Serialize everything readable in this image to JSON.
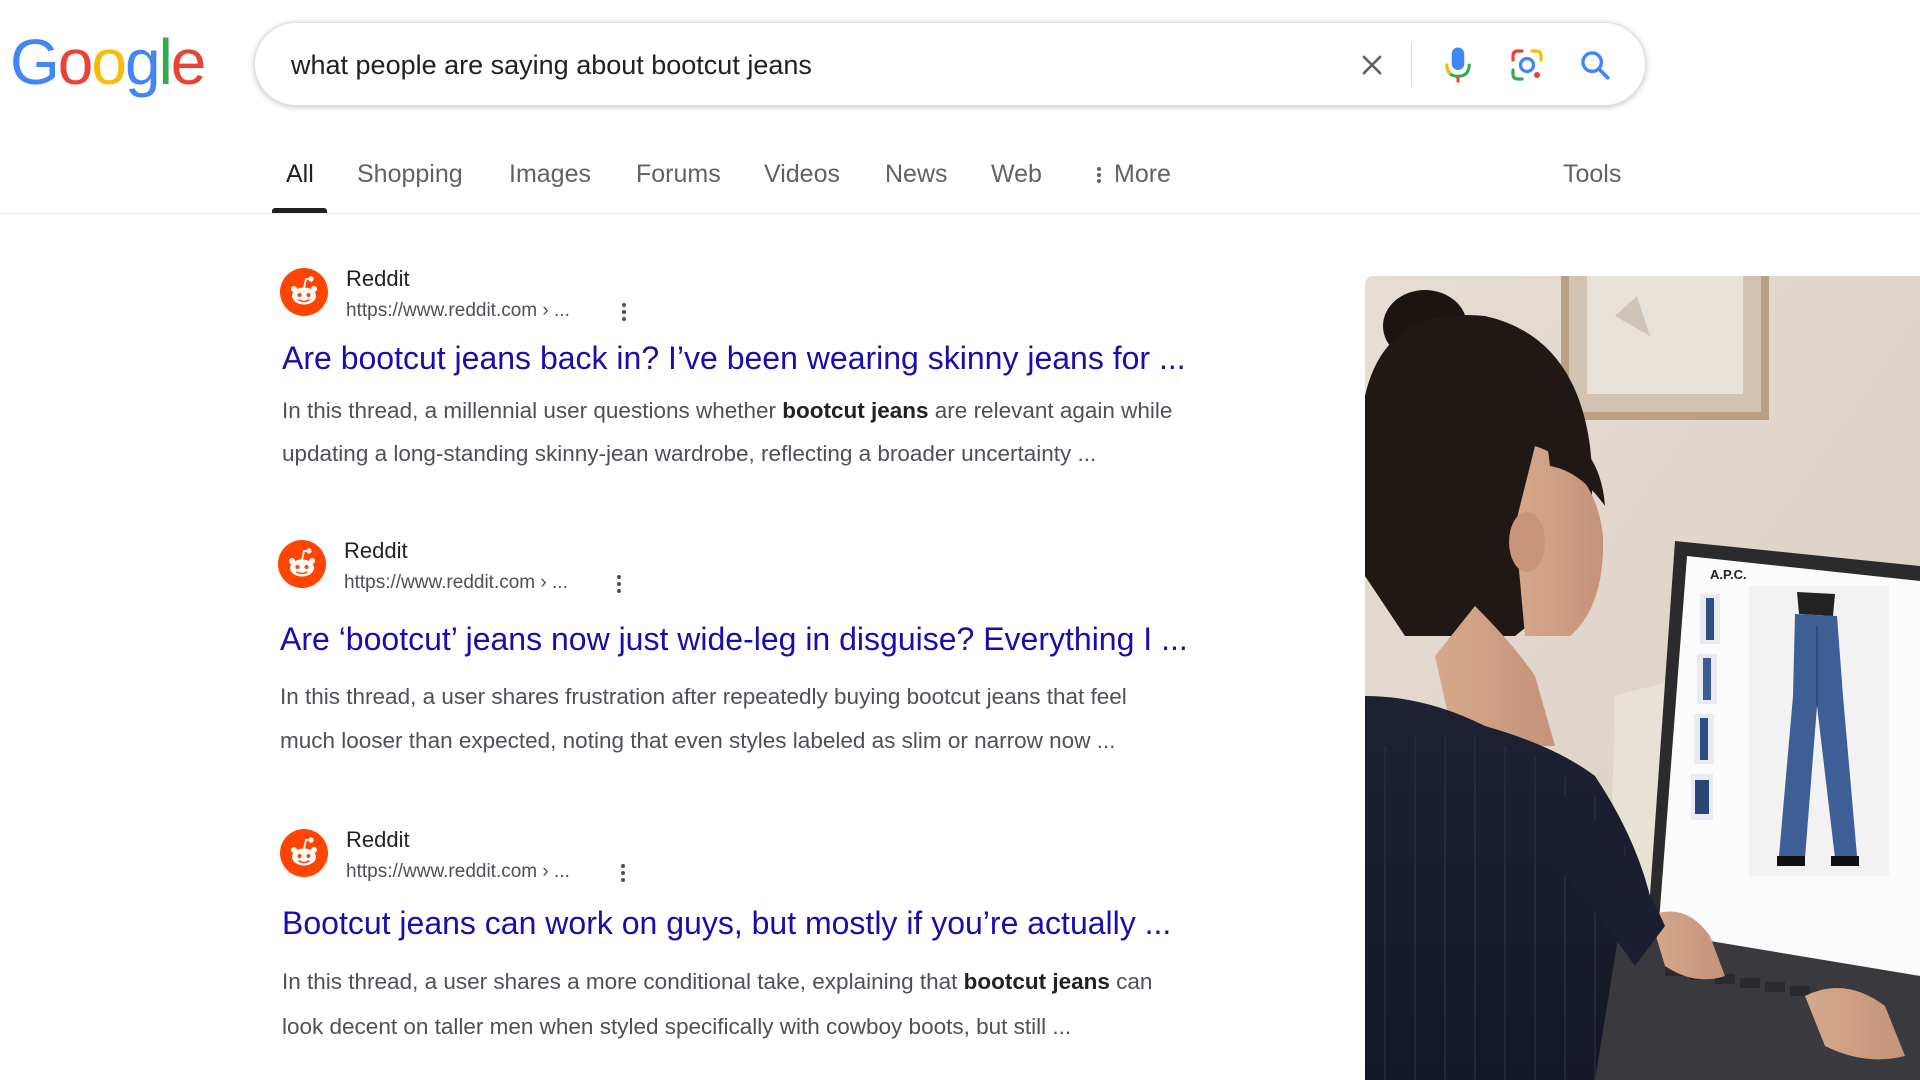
{
  "logo": {
    "letters": [
      "G",
      "o",
      "o",
      "g",
      "l",
      "e"
    ]
  },
  "search": {
    "query": "what people are saying about bootcut jeans"
  },
  "tabs": [
    {
      "label": "All",
      "active": true
    },
    {
      "label": "Shopping"
    },
    {
      "label": "Images"
    },
    {
      "label": "Forums"
    },
    {
      "label": "Videos"
    },
    {
      "label": "News"
    },
    {
      "label": "Web"
    },
    {
      "label": "More"
    }
  ],
  "tools_label": "Tools",
  "results": [
    {
      "site": "Reddit",
      "url": "https://www.reddit.com › ...",
      "title": "Are bootcut jeans back in? I’ve been wearing skinny jeans for ...",
      "snippet_line1_pre": "In this thread, a millennial user questions whether ",
      "snippet_line1_bold": "bootcut jeans",
      "snippet_line1_post": " are relevant again while",
      "snippet_line2": "updating a long-standing skinny-jean wardrobe, reflecting a broader uncertainty ..."
    },
    {
      "site": "Reddit",
      "url": "https://www.reddit.com › ...",
      "title": "Are ‘bootcut’ jeans now just wide-leg in disguise? Everything I ...",
      "snippet_line1": "In this thread, a user shares frustration after repeatedly buying bootcut jeans that feel",
      "snippet_line2": "much looser than expected, noting that even styles labeled as slim or narrow now ..."
    },
    {
      "site": "Reddit",
      "url": "https://www.reddit.com › ...",
      "title": "Bootcut jeans can work on guys, but mostly if you’re actually ...",
      "snippet_line1_pre": "In this thread, a user shares a more conditional take, explaining that ",
      "snippet_line1_bold": "bootcut jeans",
      "snippet_line1_post": " can",
      "snippet_line2": "look decent on taller men when styled specifically with cowboy boots, but still ..."
    }
  ],
  "photo": {
    "screen_brand": "A.P.C."
  },
  "colors": {
    "link": "#1a0dab",
    "reddit": "#ff4500",
    "google_blue": "#4285F4",
    "google_red": "#EA4335",
    "google_yellow": "#FBBC05",
    "google_green": "#34A853"
  },
  "icons": [
    "clear-icon",
    "microphone-icon",
    "lens-icon",
    "search-icon",
    "more-dots-icon",
    "reddit-icon",
    "kebab-menu-icon"
  ]
}
